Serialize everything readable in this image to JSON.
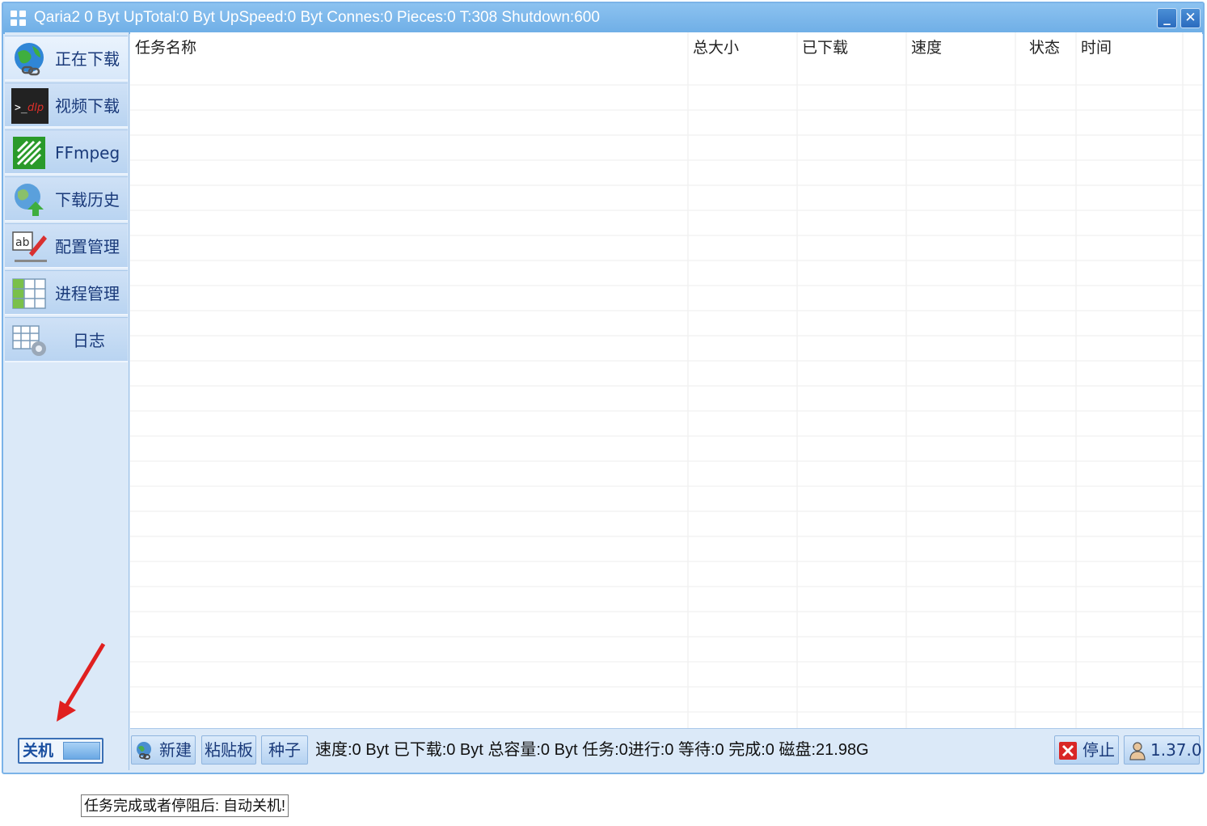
{
  "window": {
    "title": "Qaria2 0 Byt UpTotal:0 Byt UpSpeed:0 Byt Connes:0 Pieces:0 T:308 Shutdown:600",
    "minimize_glyph": "_",
    "close_glyph": "✕"
  },
  "sidebar": {
    "items": [
      {
        "label": "正在下载",
        "icon": "globe-link-icon"
      },
      {
        "label": "视频下载",
        "icon": "dlp-terminal-icon"
      },
      {
        "label": "FFmpeg",
        "icon": "ffmpeg-icon"
      },
      {
        "label": "下载历史",
        "icon": "globe-upload-icon"
      },
      {
        "label": "配置管理",
        "icon": "ab-pen-icon"
      },
      {
        "label": "进程管理",
        "icon": "table-grid-icon"
      },
      {
        "label": "日志",
        "icon": "grid-gear-icon"
      }
    ],
    "shutdown_label": "关机"
  },
  "table": {
    "columns": [
      "任务名称",
      "总大小",
      "已下载",
      "速度",
      "状态",
      "时间"
    ],
    "rows": []
  },
  "statusbar": {
    "new_label": "新建",
    "clipboard_label": "粘贴板",
    "torrent_label": "种子",
    "status_text": "速度:0 Byt 已下载:0 Byt 总容量:0 Byt 任务:0进行:0 等待:0 完成:0 磁盘:21.98G",
    "stop_label": "停止",
    "version_label": "1.37.0"
  },
  "tooltip": {
    "text": "任务完成或者停阻后: 自动关机!"
  },
  "colors": {
    "titlebar": "#7ab8ec",
    "sidebar_bg": "#dbe9f8",
    "arrow": "#e02020",
    "accent_text": "#1a3a7a"
  }
}
